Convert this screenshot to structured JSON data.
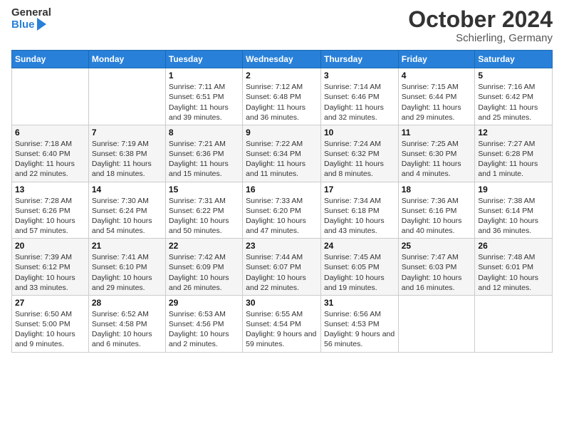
{
  "header": {
    "logo_general": "General",
    "logo_blue": "Blue",
    "title": "October 2024",
    "subtitle": "Schierling, Germany"
  },
  "days_of_week": [
    "Sunday",
    "Monday",
    "Tuesday",
    "Wednesday",
    "Thursday",
    "Friday",
    "Saturday"
  ],
  "weeks": [
    [
      {
        "day": "",
        "sunrise": "",
        "sunset": "",
        "daylight": "",
        "empty": true
      },
      {
        "day": "",
        "sunrise": "",
        "sunset": "",
        "daylight": "",
        "empty": true
      },
      {
        "day": "1",
        "sunrise": "Sunrise: 7:11 AM",
        "sunset": "Sunset: 6:51 PM",
        "daylight": "Daylight: 11 hours and 39 minutes."
      },
      {
        "day": "2",
        "sunrise": "Sunrise: 7:12 AM",
        "sunset": "Sunset: 6:48 PM",
        "daylight": "Daylight: 11 hours and 36 minutes."
      },
      {
        "day": "3",
        "sunrise": "Sunrise: 7:14 AM",
        "sunset": "Sunset: 6:46 PM",
        "daylight": "Daylight: 11 hours and 32 minutes."
      },
      {
        "day": "4",
        "sunrise": "Sunrise: 7:15 AM",
        "sunset": "Sunset: 6:44 PM",
        "daylight": "Daylight: 11 hours and 29 minutes."
      },
      {
        "day": "5",
        "sunrise": "Sunrise: 7:16 AM",
        "sunset": "Sunset: 6:42 PM",
        "daylight": "Daylight: 11 hours and 25 minutes."
      }
    ],
    [
      {
        "day": "6",
        "sunrise": "Sunrise: 7:18 AM",
        "sunset": "Sunset: 6:40 PM",
        "daylight": "Daylight: 11 hours and 22 minutes."
      },
      {
        "day": "7",
        "sunrise": "Sunrise: 7:19 AM",
        "sunset": "Sunset: 6:38 PM",
        "daylight": "Daylight: 11 hours and 18 minutes."
      },
      {
        "day": "8",
        "sunrise": "Sunrise: 7:21 AM",
        "sunset": "Sunset: 6:36 PM",
        "daylight": "Daylight: 11 hours and 15 minutes."
      },
      {
        "day": "9",
        "sunrise": "Sunrise: 7:22 AM",
        "sunset": "Sunset: 6:34 PM",
        "daylight": "Daylight: 11 hours and 11 minutes."
      },
      {
        "day": "10",
        "sunrise": "Sunrise: 7:24 AM",
        "sunset": "Sunset: 6:32 PM",
        "daylight": "Daylight: 11 hours and 8 minutes."
      },
      {
        "day": "11",
        "sunrise": "Sunrise: 7:25 AM",
        "sunset": "Sunset: 6:30 PM",
        "daylight": "Daylight: 11 hours and 4 minutes."
      },
      {
        "day": "12",
        "sunrise": "Sunrise: 7:27 AM",
        "sunset": "Sunset: 6:28 PM",
        "daylight": "Daylight: 11 hours and 1 minute."
      }
    ],
    [
      {
        "day": "13",
        "sunrise": "Sunrise: 7:28 AM",
        "sunset": "Sunset: 6:26 PM",
        "daylight": "Daylight: 10 hours and 57 minutes."
      },
      {
        "day": "14",
        "sunrise": "Sunrise: 7:30 AM",
        "sunset": "Sunset: 6:24 PM",
        "daylight": "Daylight: 10 hours and 54 minutes."
      },
      {
        "day": "15",
        "sunrise": "Sunrise: 7:31 AM",
        "sunset": "Sunset: 6:22 PM",
        "daylight": "Daylight: 10 hours and 50 minutes."
      },
      {
        "day": "16",
        "sunrise": "Sunrise: 7:33 AM",
        "sunset": "Sunset: 6:20 PM",
        "daylight": "Daylight: 10 hours and 47 minutes."
      },
      {
        "day": "17",
        "sunrise": "Sunrise: 7:34 AM",
        "sunset": "Sunset: 6:18 PM",
        "daylight": "Daylight: 10 hours and 43 minutes."
      },
      {
        "day": "18",
        "sunrise": "Sunrise: 7:36 AM",
        "sunset": "Sunset: 6:16 PM",
        "daylight": "Daylight: 10 hours and 40 minutes."
      },
      {
        "day": "19",
        "sunrise": "Sunrise: 7:38 AM",
        "sunset": "Sunset: 6:14 PM",
        "daylight": "Daylight: 10 hours and 36 minutes."
      }
    ],
    [
      {
        "day": "20",
        "sunrise": "Sunrise: 7:39 AM",
        "sunset": "Sunset: 6:12 PM",
        "daylight": "Daylight: 10 hours and 33 minutes."
      },
      {
        "day": "21",
        "sunrise": "Sunrise: 7:41 AM",
        "sunset": "Sunset: 6:10 PM",
        "daylight": "Daylight: 10 hours and 29 minutes."
      },
      {
        "day": "22",
        "sunrise": "Sunrise: 7:42 AM",
        "sunset": "Sunset: 6:09 PM",
        "daylight": "Daylight: 10 hours and 26 minutes."
      },
      {
        "day": "23",
        "sunrise": "Sunrise: 7:44 AM",
        "sunset": "Sunset: 6:07 PM",
        "daylight": "Daylight: 10 hours and 22 minutes."
      },
      {
        "day": "24",
        "sunrise": "Sunrise: 7:45 AM",
        "sunset": "Sunset: 6:05 PM",
        "daylight": "Daylight: 10 hours and 19 minutes."
      },
      {
        "day": "25",
        "sunrise": "Sunrise: 7:47 AM",
        "sunset": "Sunset: 6:03 PM",
        "daylight": "Daylight: 10 hours and 16 minutes."
      },
      {
        "day": "26",
        "sunrise": "Sunrise: 7:48 AM",
        "sunset": "Sunset: 6:01 PM",
        "daylight": "Daylight: 10 hours and 12 minutes."
      }
    ],
    [
      {
        "day": "27",
        "sunrise": "Sunrise: 6:50 AM",
        "sunset": "Sunset: 5:00 PM",
        "daylight": "Daylight: 10 hours and 9 minutes."
      },
      {
        "day": "28",
        "sunrise": "Sunrise: 6:52 AM",
        "sunset": "Sunset: 4:58 PM",
        "daylight": "Daylight: 10 hours and 6 minutes."
      },
      {
        "day": "29",
        "sunrise": "Sunrise: 6:53 AM",
        "sunset": "Sunset: 4:56 PM",
        "daylight": "Daylight: 10 hours and 2 minutes."
      },
      {
        "day": "30",
        "sunrise": "Sunrise: 6:55 AM",
        "sunset": "Sunset: 4:54 PM",
        "daylight": "Daylight: 9 hours and 59 minutes."
      },
      {
        "day": "31",
        "sunrise": "Sunrise: 6:56 AM",
        "sunset": "Sunset: 4:53 PM",
        "daylight": "Daylight: 9 hours and 56 minutes."
      },
      {
        "day": "",
        "sunrise": "",
        "sunset": "",
        "daylight": "",
        "empty": true
      },
      {
        "day": "",
        "sunrise": "",
        "sunset": "",
        "daylight": "",
        "empty": true
      }
    ]
  ]
}
